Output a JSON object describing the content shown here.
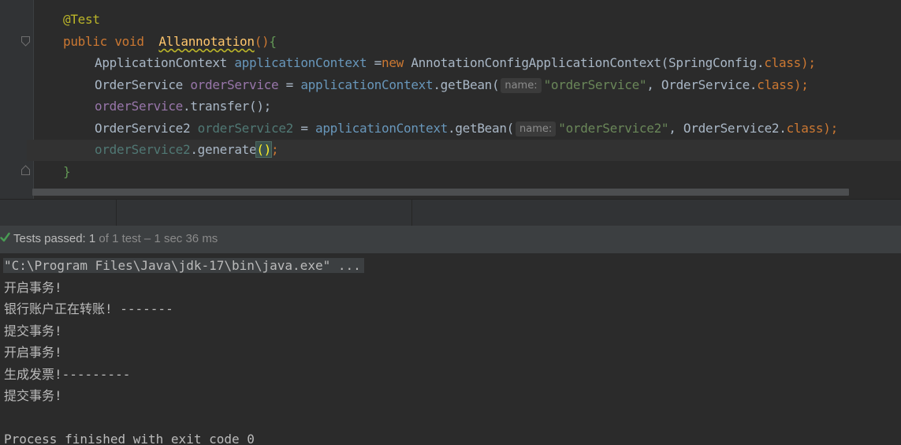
{
  "editor": {
    "lines": {
      "l1": {
        "annotation": "@Test"
      },
      "l2": {
        "kw_public": "public",
        "kw_void": "void",
        "method": "Allannotation",
        "parens": "()",
        "brace": "{"
      },
      "l3": {
        "type": "ApplicationContext",
        "var": "applicationContext",
        "assign": " =",
        "kw_new": "new",
        "ctor": " AnnotationConfigApplicationContext(SpringConfig.",
        "kw_class": "class",
        "end": ");"
      },
      "l4": {
        "type": "OrderService",
        "var": "orderService",
        "assign": " = ",
        "ref": "applicationContext",
        "call": ".getBean(",
        "hint": "name:",
        "str": "\"orderService\"",
        "rest": ", OrderService.",
        "kw_class": "class",
        "end": ");"
      },
      "l5": {
        "var": "orderService",
        "call": ".transfer();"
      },
      "l6": {
        "type": "OrderService2",
        "var": "orderService2",
        "assign": " = ",
        "ref": "applicationContext",
        "call": ".getBean(",
        "hint": "name:",
        "str": "\"orderService2\"",
        "rest": ", OrderService2.",
        "kw_class": "class",
        "end": ");"
      },
      "l7": {
        "var": "orderService2",
        "call": ".generate",
        "paren": "()",
        "end": ";"
      },
      "l8": {
        "brace": "}"
      }
    }
  },
  "run_panel": {
    "status": {
      "label": "Tests passed: ",
      "count": "1",
      "detail": " of 1 test – 1 sec 36 ms"
    },
    "console": [
      "\"C:\\Program Files\\Java\\jdk-17\\bin\\java.exe\" ...",
      "开启事务!",
      "银行账户正在转账! -------",
      "提交事务!",
      "开启事务!",
      "生成发票!---------",
      "提交事务!",
      "",
      "Process finished with exit code 0"
    ]
  },
  "colors": {
    "background": "#2b2b2b",
    "keyword": "#cc7832",
    "annotation": "#bbb529",
    "string": "#6a8759",
    "field": "#9876aa",
    "success": "#499c54"
  },
  "icons": [
    "fold-open-icon",
    "fold-close-icon",
    "check-icon"
  ]
}
